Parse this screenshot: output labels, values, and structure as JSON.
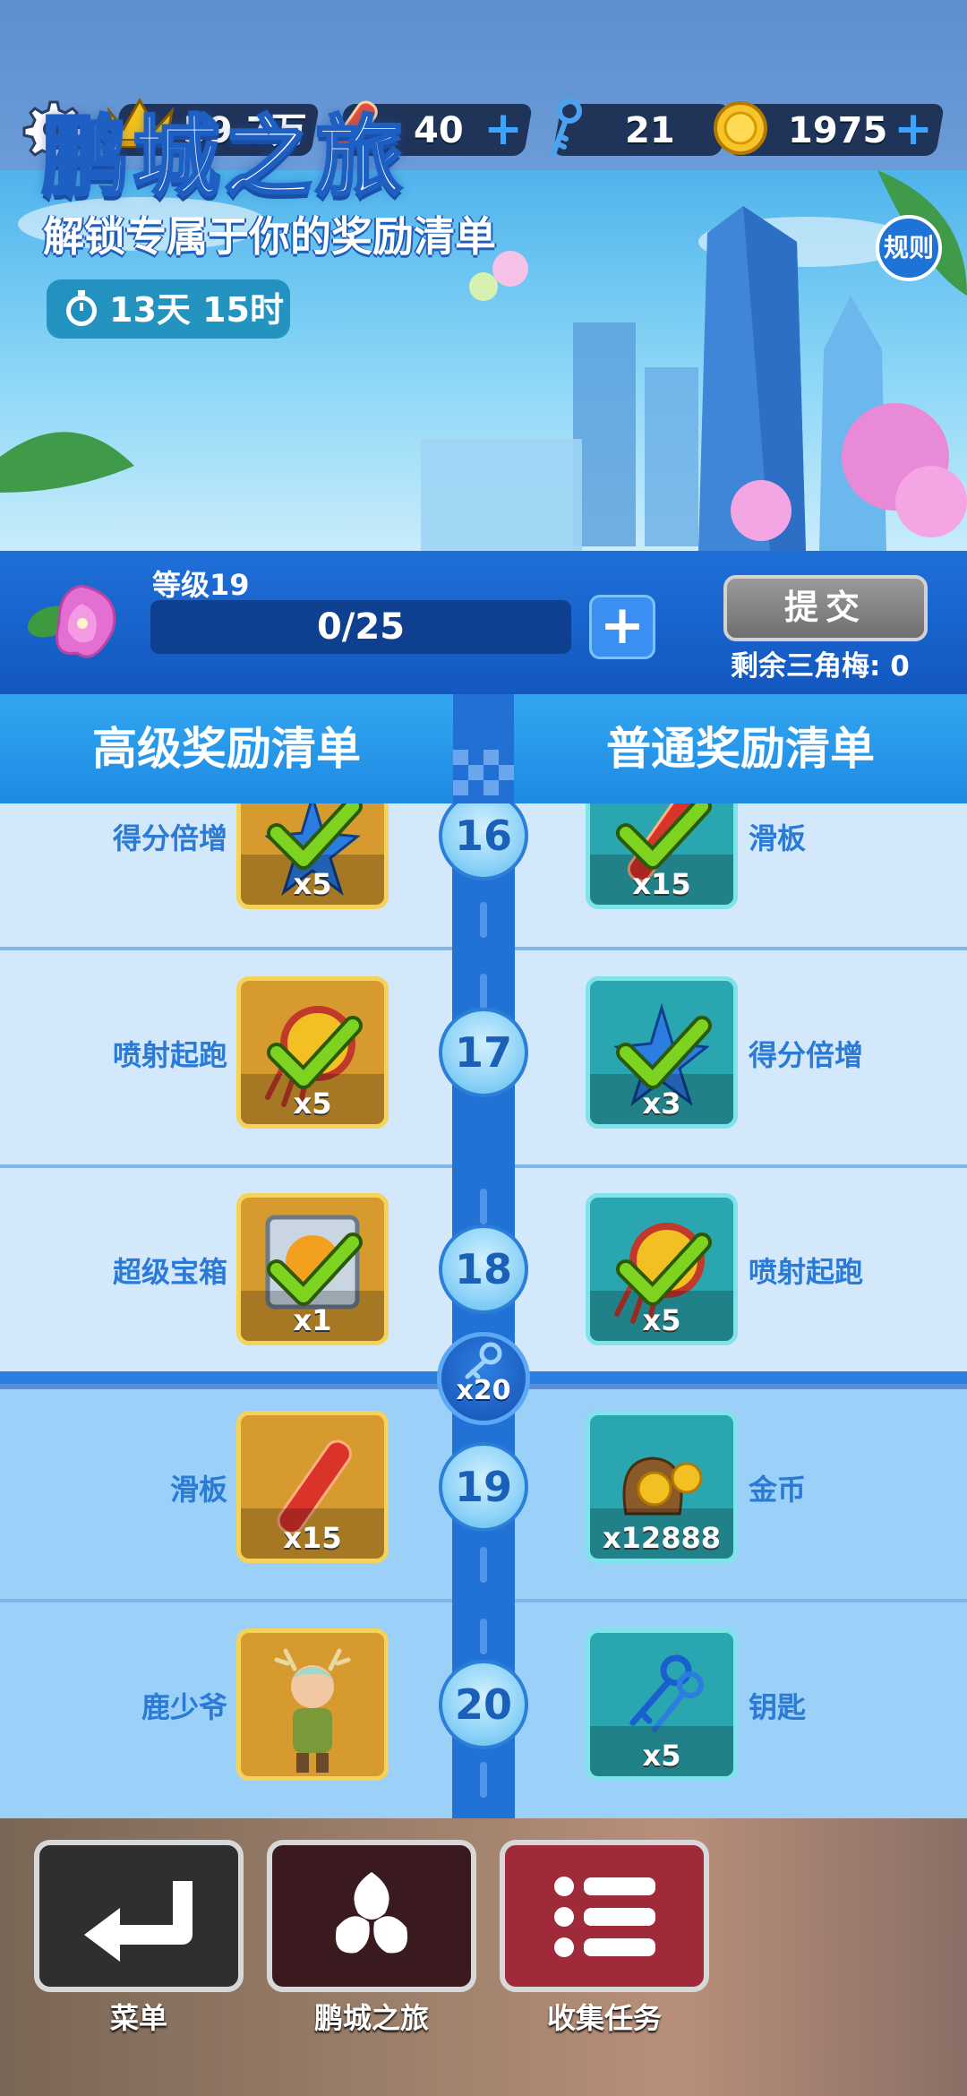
{
  "topbar": {
    "settings_icon": "gear-icon",
    "crown_value": "59.7万",
    "board_value": "40",
    "key_value": "21",
    "coin_value": "1975",
    "plus_symbol": "+"
  },
  "banner": {
    "title": "鹏城之旅",
    "subtitle": "解锁专属于你的奖励清单",
    "timer": "13天 15时",
    "rules_label": "规则"
  },
  "level": {
    "label": "等级19",
    "progress_text": "0/25",
    "progress_fraction": 0,
    "plus_label": "+",
    "submit_label": "提交",
    "remaining_text": "剩余三角梅: 0"
  },
  "headers": {
    "premium": "高级奖励清单",
    "normal": "普通奖励清单"
  },
  "rows": [
    {
      "level": "16",
      "premium": {
        "name": "得分倍增",
        "qty": "x5",
        "icon": "star-multiplier-icon",
        "claimed": true
      },
      "normal": {
        "name": "滑板",
        "qty": "x15",
        "icon": "hoverboard-icon",
        "claimed": true
      }
    },
    {
      "level": "17",
      "premium": {
        "name": "喷射起跑",
        "qty": "x5",
        "icon": "headstart-icon",
        "claimed": true
      },
      "normal": {
        "name": "得分倍增",
        "qty": "x3",
        "icon": "star-multiplier-icon",
        "claimed": true
      }
    },
    {
      "level": "18",
      "premium": {
        "name": "超级宝箱",
        "qty": "x1",
        "icon": "super-box-icon",
        "claimed": true
      },
      "normal": {
        "name": "喷射起跑",
        "qty": "x5",
        "icon": "headstart-icon",
        "claimed": true
      }
    },
    {
      "level": "19",
      "premium": {
        "name": "滑板",
        "qty": "x15",
        "icon": "hoverboard-icon",
        "claimed": false
      },
      "normal": {
        "name": "金币",
        "qty": "x12888",
        "icon": "coin-bag-icon",
        "claimed": false
      }
    },
    {
      "level": "20",
      "premium": {
        "name": "鹿少爷",
        "qty": "",
        "icon": "character-icon",
        "claimed": false
      },
      "normal": {
        "name": "钥匙",
        "qty": "x5",
        "icon": "keys-icon",
        "claimed": false
      }
    }
  ],
  "key_milestone": {
    "qty": "x20",
    "icon": "key-icon"
  },
  "nav": {
    "menu": "菜单",
    "journey": "鹏城之旅",
    "collect": "收集任务"
  },
  "colors": {
    "premium_card": "#d69a2e",
    "normal_card": "#2aa6b0",
    "check": "#6cd01c",
    "accent_blue": "#2272d6"
  }
}
